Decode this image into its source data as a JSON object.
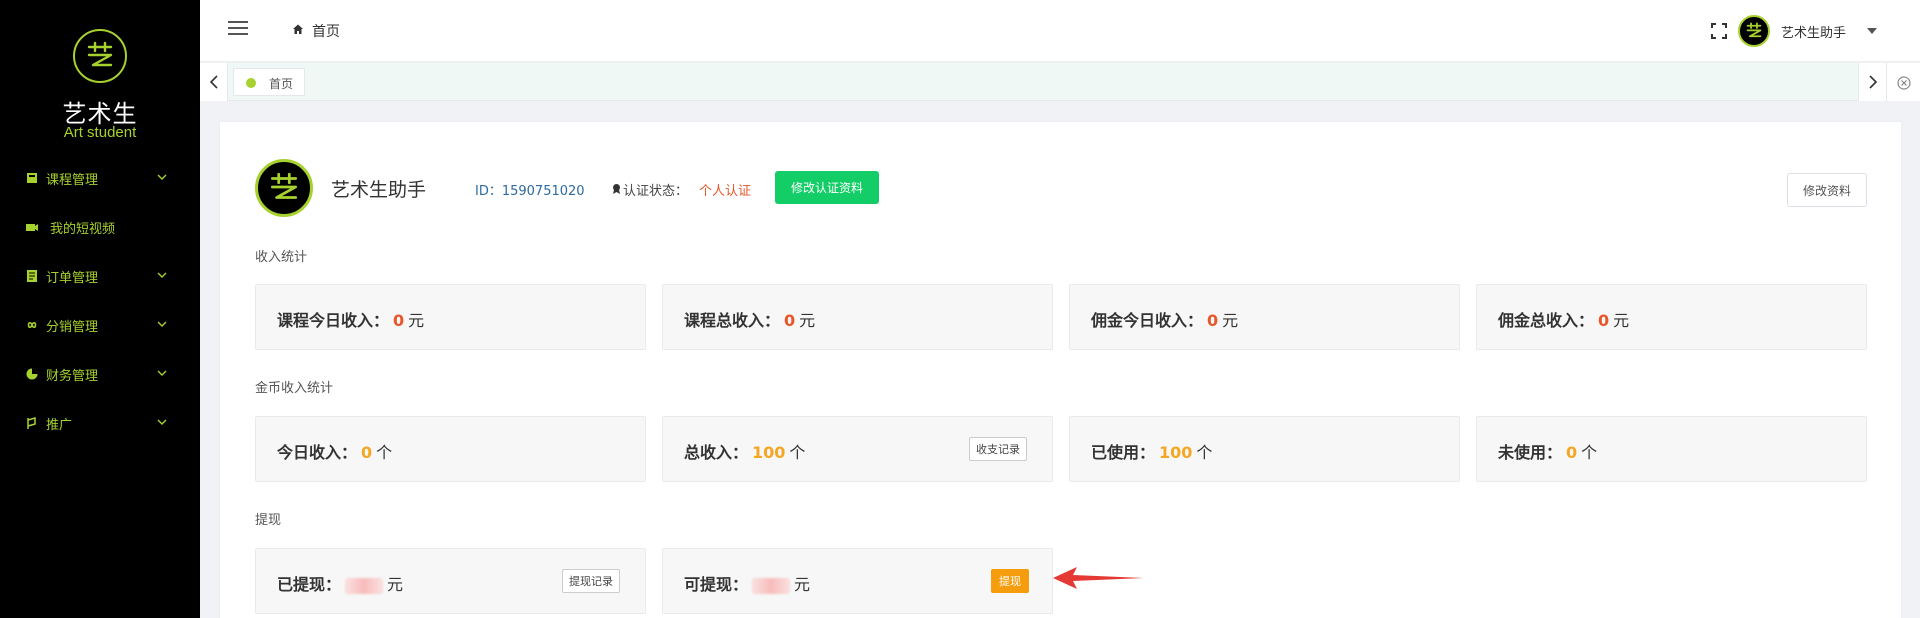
{
  "sidebar": {
    "logo_title": "艺术生",
    "logo_subtitle": "Art student",
    "accent": "#a7d12e",
    "items": [
      {
        "label": "课程管理",
        "icon": "book-icon",
        "expandable": true
      },
      {
        "label": "我的短视频",
        "icon": "video-icon",
        "expandable": false
      },
      {
        "label": "订单管理",
        "icon": "order-icon",
        "expandable": true
      },
      {
        "label": "分销管理",
        "icon": "infinity-icon",
        "expandable": true
      },
      {
        "label": "财务管理",
        "icon": "pie-chart-icon",
        "expandable": true
      },
      {
        "label": "推广",
        "icon": "promotion-icon",
        "expandable": true
      }
    ]
  },
  "header": {
    "breadcrumb": "首页",
    "user_name": "艺术生助手"
  },
  "tabs": [
    {
      "label": "首页",
      "active": true
    }
  ],
  "profile": {
    "name": "艺术生助手",
    "id_text": "ID：1590751020",
    "cert_label": "认证状态：",
    "cert_value": "个人认证",
    "edit_cert_button": "修改认证资料",
    "edit_profile_button": "修改资料"
  },
  "income": {
    "title": "收入统计",
    "cards": [
      {
        "label": "课程今日收入：",
        "value": "0",
        "unit": "元"
      },
      {
        "label": "课程总收入：",
        "value": "0",
        "unit": "元"
      },
      {
        "label": "佣金今日收入：",
        "value": "0",
        "unit": "元"
      },
      {
        "label": "佣金总收入：",
        "value": "0",
        "unit": "元"
      }
    ]
  },
  "coins": {
    "title": "金币收入统计",
    "cards": [
      {
        "label": "今日收入：",
        "value": "0",
        "unit": "个"
      },
      {
        "label": "总收入：",
        "value": "100",
        "unit": "个",
        "button": "收支记录"
      },
      {
        "label": "已使用：",
        "value": "100",
        "unit": "个"
      },
      {
        "label": "未使用：",
        "value": "0",
        "unit": "个"
      }
    ]
  },
  "withdraw": {
    "title": "提现",
    "cards": [
      {
        "label": "已提现：",
        "unit": "元",
        "button": "提现记录"
      },
      {
        "label": "可提现：",
        "unit": "元",
        "button": "提现"
      }
    ]
  },
  "colors": {
    "primary_green": "#13ce66",
    "value_red": "#e8562a",
    "value_orange": "#f5a623",
    "withdraw_button": "#f59d0c",
    "annotation_arrow": "#e53935"
  }
}
